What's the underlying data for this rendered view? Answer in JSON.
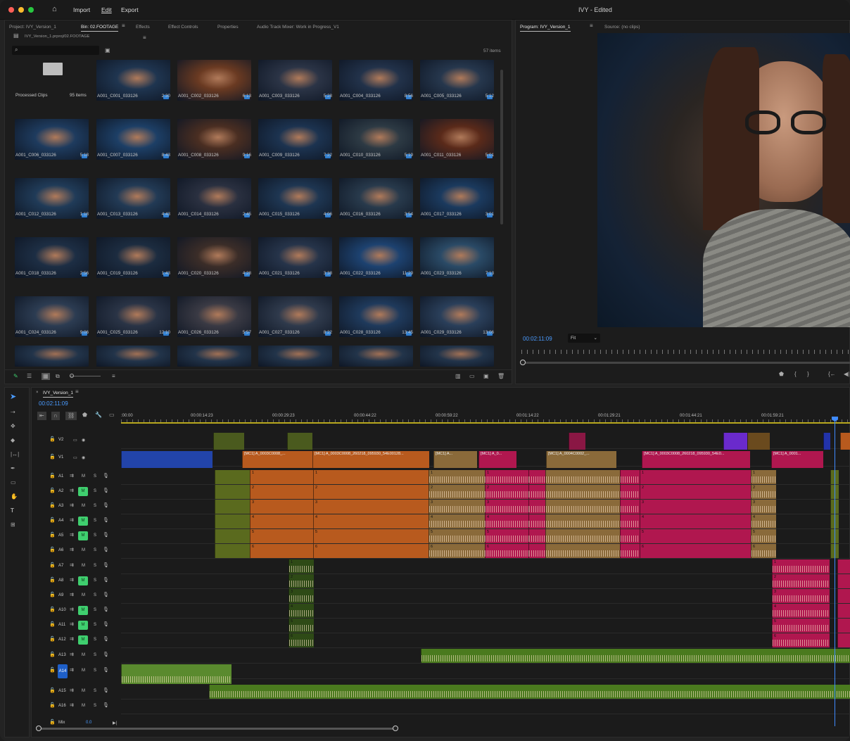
{
  "window": {
    "title": "IVY - Edited",
    "menu": [
      "Import",
      "Edit",
      "Export"
    ]
  },
  "project_panel": {
    "tabs": [
      "Project: IVY_Version_1",
      "Bin: 02.FOOTAGE",
      "Effects",
      "Effect Controls",
      "Properties",
      "Audio Track Mixer: Work in Progress_V1"
    ],
    "path": "IVY_Version_1.prproj/02.FOOTAGE",
    "item_count": "57 items",
    "folder": {
      "name": "Processed Clips",
      "count": "95 items"
    },
    "clips": [
      {
        "name": "A001_C001_033126",
        "dur": "2:30",
        "c": "#1f3550"
      },
      {
        "name": "A001_C002_033126",
        "dur": "6:13",
        "c": "#6a3a22"
      },
      {
        "name": "A001_C003_033126",
        "dur": "5:28",
        "c": "#2b3446"
      },
      {
        "name": "A001_C004_033126",
        "dur": "8:56",
        "c": "#22324a"
      },
      {
        "name": "A001_C005_033126",
        "dur": "5:12",
        "c": "#26374d"
      },
      {
        "name": "A001_C006_033126",
        "dur": "5:18",
        "c": "#1e3b5e"
      },
      {
        "name": "A001_C007_033126",
        "dur": "8:43",
        "c": "#1d3f66"
      },
      {
        "name": "A001_C008_033126",
        "dur": "9:16",
        "c": "#4a2e22"
      },
      {
        "name": "A001_C009_033126",
        "dur": "7:22",
        "c": "#1c3350"
      },
      {
        "name": "A001_C010_033126",
        "dur": "5:19",
        "c": "#2d3a44"
      },
      {
        "name": "A001_C011_033126",
        "dur": "5:01",
        "c": "#5a2a1a"
      },
      {
        "name": "A001_C012_033126",
        "dur": "1:18",
        "c": "#203b58"
      },
      {
        "name": "A001_C013_033126",
        "dur": "4:43",
        "c": "#223a55"
      },
      {
        "name": "A001_C014_033126",
        "dur": "2:45",
        "c": "#2a3040"
      },
      {
        "name": "A001_C015_033126",
        "dur": "4:06",
        "c": "#1e3652"
      },
      {
        "name": "A001_C016_033126",
        "dur": "3:54",
        "c": "#283a4c"
      },
      {
        "name": "A001_C017_033126",
        "dur": "3:01",
        "c": "#1b3a5e"
      },
      {
        "name": "A001_C018_033126",
        "dur": "2:56",
        "c": "#1d2e44"
      },
      {
        "name": "A001_C019_033126",
        "dur": "1:43",
        "c": "#1c2c40"
      },
      {
        "name": "A001_C020_033126",
        "dur": "4:28",
        "c": "#3b2d28"
      },
      {
        "name": "A001_C021_033126",
        "dur": "3:38",
        "c": "#26344a"
      },
      {
        "name": "A001_C022_033126",
        "dur": "11:29",
        "c": "#1d4270"
      },
      {
        "name": "A001_C023_033126",
        "dur": "7:13",
        "c": "#2a4a66"
      },
      {
        "name": "A001_C024_033126",
        "dur": "9:06",
        "c": "#2c3c52"
      },
      {
        "name": "A001_C025_033126",
        "dur": "12:10",
        "c": "#2a3446"
      },
      {
        "name": "A001_C026_033126",
        "dur": "5:57",
        "c": "#3a3a44"
      },
      {
        "name": "A001_C027_033126",
        "dur": "8:22",
        "c": "#2f3a4c"
      },
      {
        "name": "A001_C028_033126",
        "dur": "13:45",
        "c": "#1f3a5c"
      },
      {
        "name": "A001_C029_033126",
        "dur": "13:06",
        "c": "#2a3f5a"
      }
    ]
  },
  "program_monitor": {
    "tabs": [
      "Program: IVY_Version_1",
      "Source: (no clips)"
    ],
    "timecode": "00:02:11:09",
    "zoom": "Fit"
  },
  "timeline": {
    "sequence": "IVY_Version_1",
    "timecode": "00:02:11:09",
    "ruler": [
      ":00:00",
      "00:00:14:23",
      "00:00:29:23",
      "00:00:44:22",
      "00:00:59:22",
      "00:01:14:22",
      "00:01:29:21",
      "00:01:44:21",
      "00:01:59:21"
    ],
    "video_tracks": [
      "V2",
      "V1"
    ],
    "audio_tracks": [
      {
        "name": "A1",
        "m_on": false
      },
      {
        "name": "A2",
        "m_on": true
      },
      {
        "name": "A3",
        "m_on": false
      },
      {
        "name": "A4",
        "m_on": true
      },
      {
        "name": "A5",
        "m_on": true
      },
      {
        "name": "A6",
        "m_on": false
      },
      {
        "name": "A7",
        "m_on": false
      },
      {
        "name": "A8",
        "m_on": true
      },
      {
        "name": "A9",
        "m_on": false
      },
      {
        "name": "A10",
        "m_on": true
      },
      {
        "name": "A11",
        "m_on": true
      },
      {
        "name": "A12",
        "m_on": true
      },
      {
        "name": "A13",
        "m_on": false
      },
      {
        "name": "A14",
        "m_on": false
      },
      {
        "name": "A15",
        "m_on": false
      },
      {
        "name": "A16",
        "m_on": false
      }
    ],
    "mix_label": "Mix",
    "mix_value": "0.0",
    "v1_clips": [
      "[MC1] A_0003C0008_...",
      "[MC1] A_0003C0008_260218_095930_54E00128...",
      "[MC1] A...",
      "[MC1] A_0...",
      "[MC1] A_0004C0002_...",
      "[MC1] A_0003C0008_260218_095930_54E0...",
      "[MC1] A_0001..."
    ],
    "toggle_labels": {
      "m": "M",
      "s": "S"
    },
    "track_nums": [
      "1",
      "2",
      "3",
      "4",
      "5",
      "6"
    ],
    "fx": "fx",
    "colors": {
      "orange": "#b85a1e",
      "tan": "#8a6a3a",
      "magenta": "#b0174f",
      "green": "#4a7a1e",
      "blue": "#2244aa"
    }
  }
}
